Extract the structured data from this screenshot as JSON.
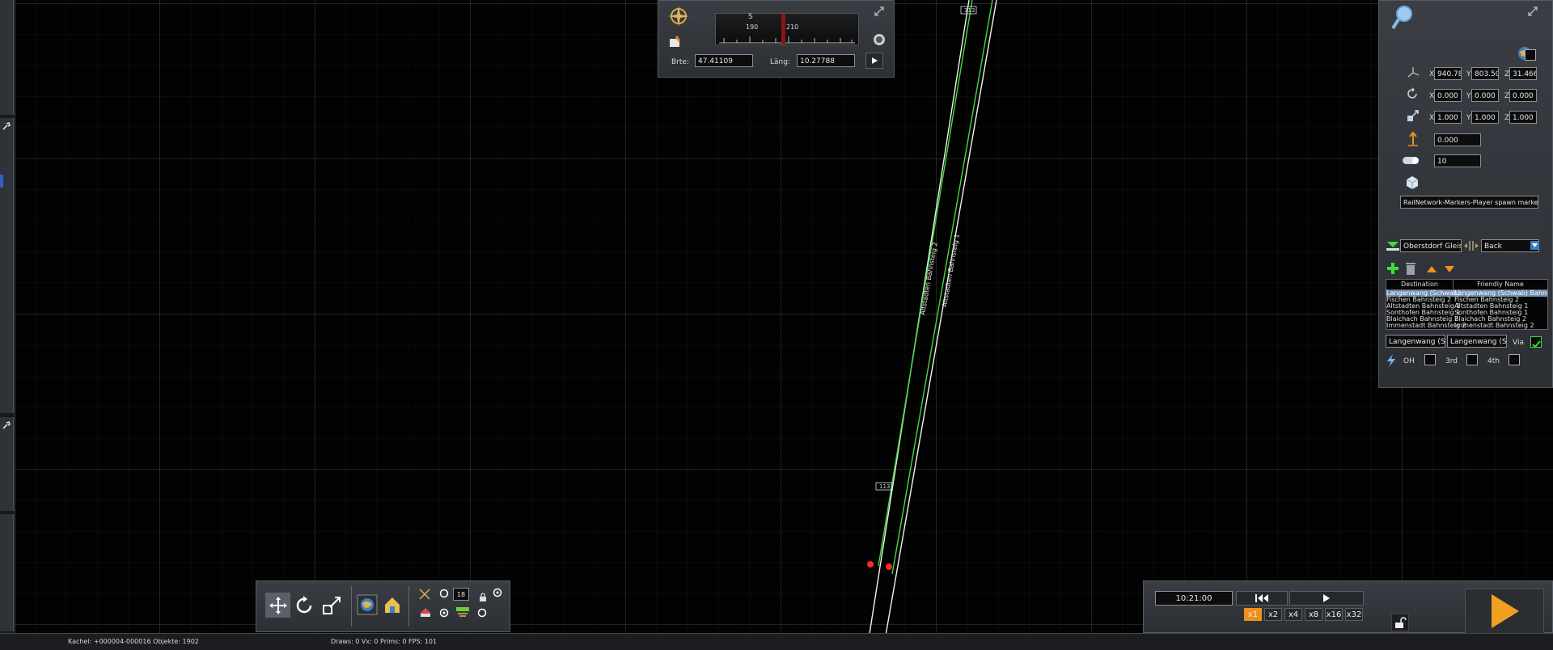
{
  "viewport": {
    "track_labels": [
      "Altstadten Bahnsteig 2",
      "Altstadten Bahnsteig 1"
    ],
    "signal_labels": [
      "113",
      "113"
    ]
  },
  "compass": {
    "letter": "S",
    "ticks": [
      "190",
      "210"
    ],
    "lat_label": "Brte:",
    "lat_value": "47.41109",
    "lon_label": "Läng:",
    "lon_value": "10.27788"
  },
  "properties": {
    "position": {
      "x": "940.784",
      "y": "803.502",
      "z": "31.466"
    },
    "rotation": {
      "x": "0.000",
      "y": "0.000",
      "z": "0.000"
    },
    "scale": {
      "x": "1.000",
      "y": "1.000",
      "z": "1.000"
    },
    "height": "0.000",
    "amount": "10",
    "object_name": "RailNetwork-Markers-Player spawn marker",
    "station": "Oberstdorf Gleis 4",
    "direction": "Back",
    "table": {
      "headers": [
        "Destination",
        "Friendly Name"
      ],
      "rows": [
        [
          "Langenwang (Schwab)",
          "Langenwang (Schwab) Bahns"
        ],
        [
          "Fischen Bahnsteig 2",
          "Fischen Bahnsteig 2"
        ],
        [
          "Altstadten Bahnsteig 1",
          "Altstadten Bahnsteig 1"
        ],
        [
          "Sonthofen Bahnsteig 1",
          "Sonthofen Bahnsteig 1"
        ],
        [
          "Blaichach Bahnsteig 2",
          "Blaichach Bahnsteig 2"
        ],
        [
          "Immenstadt Bahnsteig 2",
          "Immenstadt Bahnsteig 2"
        ]
      ]
    },
    "edit_destination": "Langenwang (Schwab)",
    "edit_friendly": "Langenwang (Schwab)",
    "via_label": "Via",
    "power_labels": [
      "OH",
      "3rd",
      "4th"
    ]
  },
  "toolbar": {
    "counter": "18"
  },
  "time": {
    "clock": "10:21:00",
    "speeds": [
      "x1",
      "x2",
      "x4",
      "x8",
      "x16",
      "x32"
    ],
    "active_speed": "x1"
  },
  "status": {
    "tile_info": "Kachel: +000004-000016  Objekte: 1902",
    "render_info": "Draws: 0 Vx: 0 Prims: 0 FPS: 101"
  },
  "colors": {
    "track_green": "#3fdc3f",
    "accent_orange": "#f0901a",
    "marker_red": "#ff2b2b",
    "selection_blue": "#6f8fb3"
  }
}
